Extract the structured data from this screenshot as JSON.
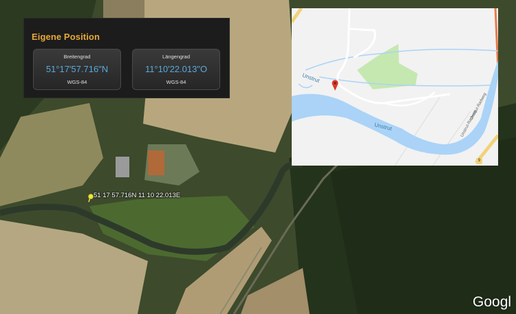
{
  "panel": {
    "title": "Eigene Position",
    "latitude": {
      "label": "Breitengrad",
      "value": "51°17'57.716\"N",
      "datum": "WGS-84"
    },
    "longitude": {
      "label": "Längengrad",
      "value": "11°10'22.013\"O",
      "datum": "WGS-84"
    }
  },
  "satellite": {
    "placemark_label": "51 17 57.716N 11 10 22.013E",
    "attribution": "Googl"
  },
  "map": {
    "labels": {
      "unstrut_north": "Unstrut",
      "unstrut_river": "Unstrut",
      "radweg_1": "Unstrut-Radweg",
      "radweg_2": "Unstrut-Radweg"
    },
    "road_shield": "9"
  },
  "colors": {
    "accent": "#e8a83a",
    "coord_blue": "#59a9dc",
    "water": "#aad3f7",
    "park": "#c5e8b0",
    "marker": "#d93a2a"
  }
}
